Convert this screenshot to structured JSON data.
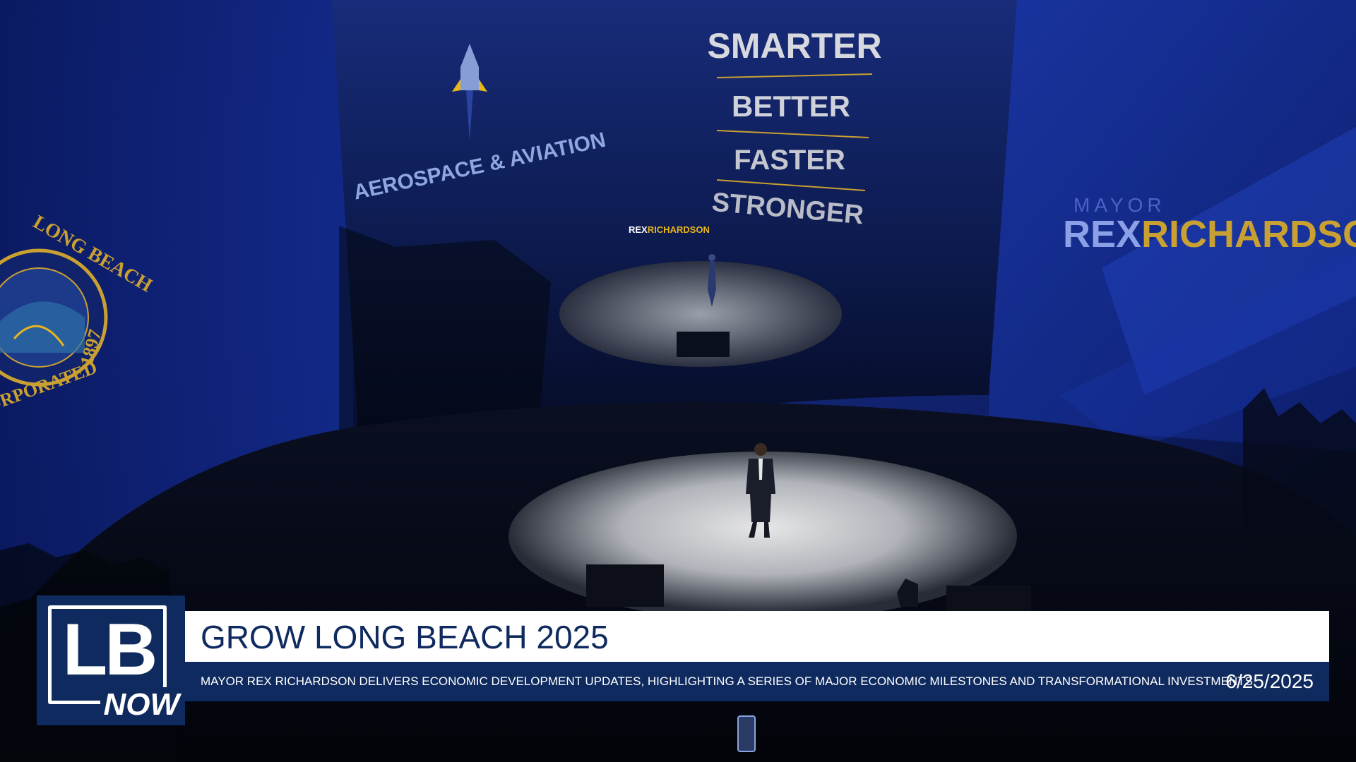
{
  "scene": {
    "screen_words": [
      "SMARTER",
      "BETTER",
      "FASTER",
      "STRONGER"
    ],
    "screen_topic": "AEROSPACE & AVIATION",
    "screen_brand_left": "REX",
    "screen_brand_right": "RICHARDSON",
    "right_panel_title": "MAYOR",
    "right_panel_name_left": "REX",
    "right_panel_name_right": "RICHARDSON",
    "seal_top": "LONG BEACH",
    "seal_bottom": "INCORPORATED",
    "seal_year": "1897",
    "colors": {
      "accent_yellow": "#e7b51c",
      "panel_blue": "#1d3bb0"
    }
  },
  "overlay": {
    "logo": {
      "main": "LB",
      "sub": "NOW"
    },
    "headline": "GROW LONG BEACH 2025",
    "ticker": "MAYOR REX RICHARDSON DELIVERS ECONOMIC DEVELOPMENT UPDATES, HIGHLIGHTING A SERIES OF MAJOR ECONOMIC MILESTONES AND TRANSFORMATIONAL INVESTMENTS.",
    "date": "6/25/2025",
    "colors": {
      "navy": "#0f2a5e",
      "white": "#ffffff"
    }
  }
}
